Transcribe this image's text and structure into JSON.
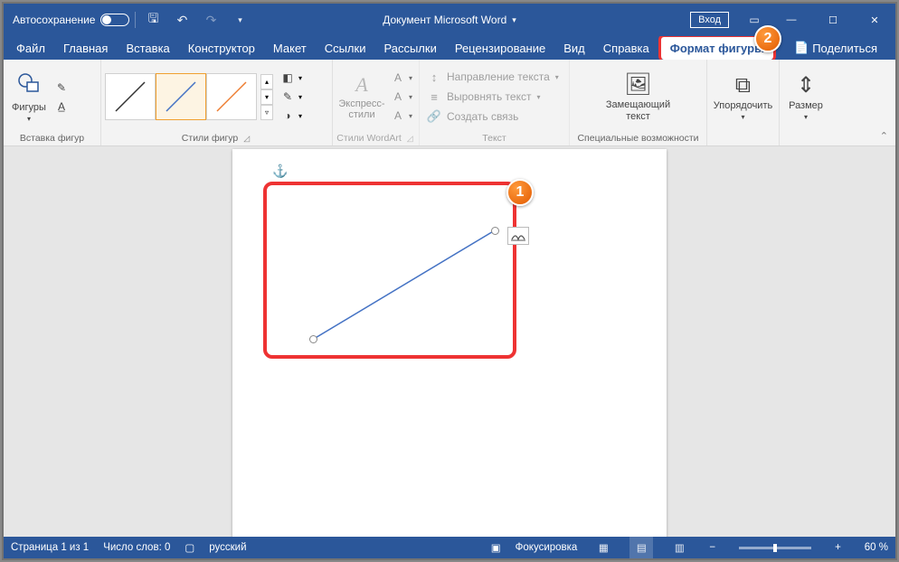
{
  "titlebar": {
    "autosave": "Автосохранение",
    "doc_title": "Документ Microsoft Word",
    "signin": "Вход"
  },
  "tabs": {
    "file": "Файл",
    "home": "Главная",
    "insert": "Вставка",
    "design": "Конструктор",
    "layout": "Макет",
    "references": "Ссылки",
    "mailings": "Рассылки",
    "review": "Рецензирование",
    "view": "Вид",
    "help": "Справка",
    "shape_format": "Формат фигуры",
    "share": "Поделиться"
  },
  "ribbon": {
    "insert_shapes": {
      "shapes": "Фигуры",
      "label": "Вставка фигур"
    },
    "shape_styles": {
      "label": "Стили фигур"
    },
    "wordart": {
      "express": "Экспресс-\nстили",
      "label": "Стили WordArt"
    },
    "text": {
      "direction": "Направление текста",
      "align": "Выровнять текст",
      "link": "Создать связь",
      "label": "Текст"
    },
    "accessibility": {
      "alt_text": "Замещающий\nтекст",
      "label": "Специальные возможности"
    },
    "arrange": {
      "arrange": "Упорядочить",
      "label": ""
    },
    "size": {
      "size": "Размер",
      "label": ""
    }
  },
  "status": {
    "page": "Страница 1 из 1",
    "words": "Число слов: 0",
    "lang": "русский",
    "focus": "Фокусировка",
    "zoom": "60 %"
  },
  "annotations": {
    "b1": "1",
    "b2": "2"
  }
}
